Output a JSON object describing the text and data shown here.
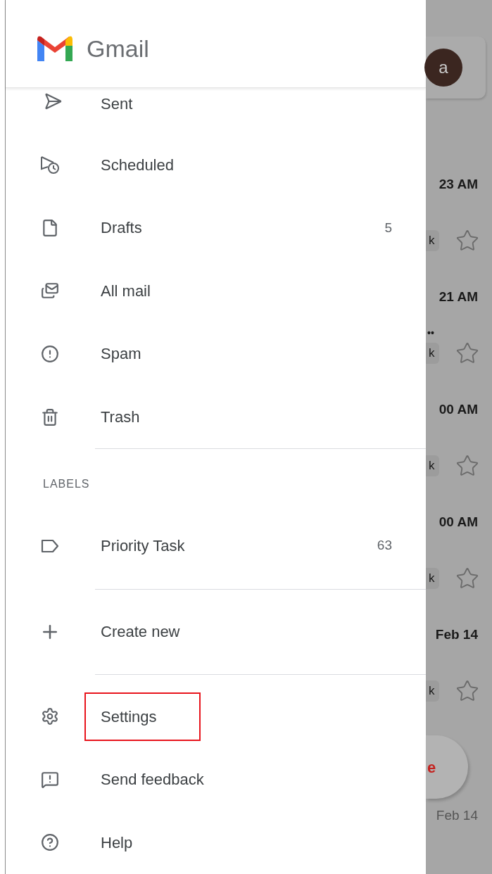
{
  "header": {
    "title": "Gmail"
  },
  "folders": [
    {
      "label": "Sent"
    },
    {
      "label": "Scheduled"
    },
    {
      "label": "Drafts",
      "count": "5"
    },
    {
      "label": "All mail"
    },
    {
      "label": "Spam"
    },
    {
      "label": "Trash"
    }
  ],
  "labels_section": {
    "heading": "LABELS",
    "items": [
      {
        "label": "Priority Task",
        "count": "63"
      }
    ]
  },
  "create_new": {
    "label": "Create new"
  },
  "footer_items": [
    {
      "label": "Settings",
      "highlighted": true
    },
    {
      "label": "Send feedback",
      "highlighted": false
    },
    {
      "label": "Help",
      "highlighted": false
    }
  ],
  "background": {
    "avatar": "a",
    "emails": [
      {
        "time": "23 AM",
        "chip": "k",
        "starred": false
      },
      {
        "time": "21 AM",
        "snippet": "••",
        "chip": "k",
        "starred": false
      },
      {
        "time": "00 AM",
        "chip": "k",
        "starred": false
      },
      {
        "time": "00 AM",
        "chip": "k",
        "starred": false
      },
      {
        "time": "Feb 14",
        "chip": "k",
        "starred": false
      }
    ],
    "compose_letter": "e",
    "last_time": "Feb 14"
  }
}
